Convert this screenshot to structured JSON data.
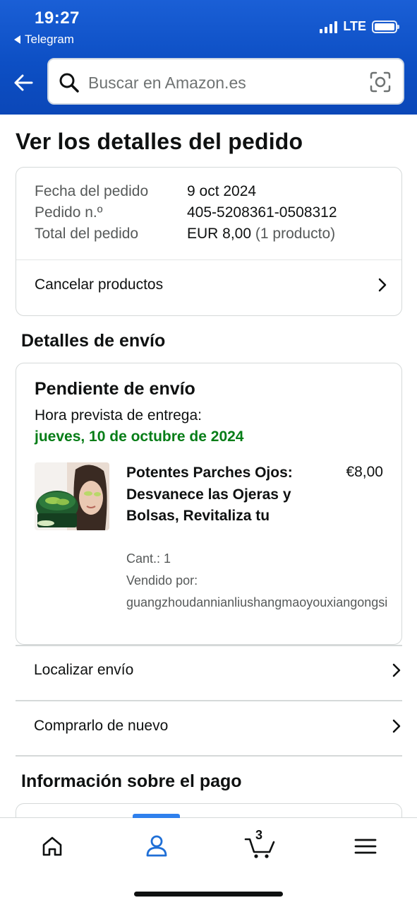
{
  "status_bar": {
    "time": "19:27",
    "back_app": "Telegram",
    "network": "LTE"
  },
  "search": {
    "placeholder": "Buscar en Amazon.es"
  },
  "page": {
    "title": "Ver los detalles del pedido"
  },
  "order_summary": {
    "date_label": "Fecha del pedido",
    "date_value": "9 oct 2024",
    "number_label": "Pedido n.º",
    "number_value": "405-5208361-0508312",
    "total_label": "Total del pedido",
    "total_value": "EUR 8,00",
    "total_count": "(1 producto)",
    "cancel_link": "Cancelar productos"
  },
  "shipping": {
    "section_title": "Detalles de envío",
    "status": "Pendiente de envío",
    "eta_label": "Hora prevista de entrega:",
    "eta_value": "jueves, 10 de octubre de 2024",
    "product": {
      "title": "Potentes Parches Ojos: Desvanece las Ojeras y Bolsas, Revitaliza tu",
      "price": "€8,00",
      "quantity": "Cant.: 1",
      "seller_label": "Vendido por:",
      "seller": "guangzhoudannianliushangmaoyouxiangongsi"
    },
    "track_link": "Localizar envío",
    "buy_again_link": "Comprarlo de nuevo"
  },
  "payment": {
    "section_title": "Información sobre el pago"
  },
  "bottom_nav": {
    "cart_count": "3",
    "items": [
      "home-icon",
      "account-icon",
      "cart-icon",
      "menu-icon"
    ]
  },
  "colors": {
    "header_blue": "#0d4fc4",
    "delivery_green": "#067d17",
    "active_indicator": "#2f80ed"
  }
}
